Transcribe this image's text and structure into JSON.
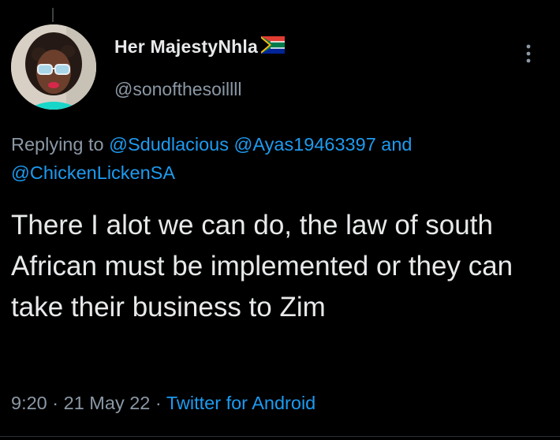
{
  "tweet": {
    "author": {
      "display_name": "Her MajestyNhla",
      "handle": "@sonofthesoillll",
      "flag_icon": "south-africa-flag-emoji"
    },
    "replying_to": {
      "prefix": "Replying to",
      "mentions": [
        "@Sdudlacious",
        "@Ayas19463397",
        "@ChickenLickenSA"
      ],
      "conjunction": "and"
    },
    "text": "There I alot we can do, the law of south African must be implemented or they can take their business to Zim",
    "time": "9:20",
    "date": "21 May 22",
    "separator": "·",
    "source": "Twitter for Android"
  },
  "colors": {
    "background": "#000000",
    "text_primary": "#e7e9ea",
    "text_secondary": "#8b98a5",
    "accent": "#1d9bf0"
  }
}
